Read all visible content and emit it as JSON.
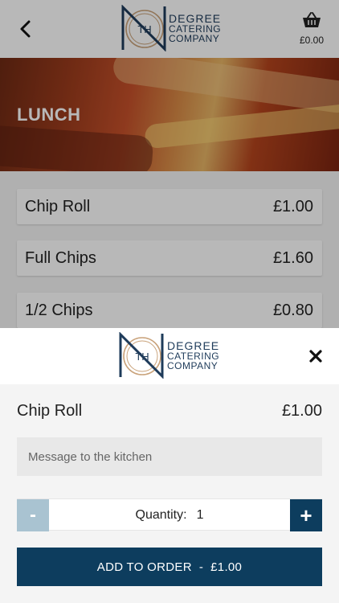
{
  "header": {
    "back_icon": "chevron-left-icon",
    "logo": {
      "mark": "TH",
      "line1": "DEGREE",
      "line2": "CATERING",
      "line3": "COMPANY"
    },
    "cart_icon": "basket-icon",
    "cart_total": "£0.00"
  },
  "hero": {
    "title": "LUNCH"
  },
  "menu": {
    "items": [
      {
        "name": "Chip Roll",
        "price": "£1.00"
      },
      {
        "name": "Full Chips",
        "price": "£1.60"
      },
      {
        "name": "1/2 Chips",
        "price": "£0.80"
      }
    ]
  },
  "sheet": {
    "logo": {
      "mark": "TH",
      "line1": "DEGREE",
      "line2": "CATERING",
      "line3": "COMPANY"
    },
    "close_icon": "close-icon",
    "item_name": "Chip Roll",
    "item_price": "£1.00",
    "message_placeholder": "Message to the kitchen",
    "quantity": {
      "minus": "-",
      "label": "Quantity:",
      "value": "1",
      "plus": "+"
    },
    "add_button": {
      "label": "ADD TO ORDER",
      "separator": "-",
      "price": "£1.00"
    }
  },
  "colors": {
    "navy": "#0d3d5e",
    "minus_disabled": "#a9c3d1",
    "logo_text": "#1e3b5a",
    "logo_ring": "#c9a27a"
  }
}
